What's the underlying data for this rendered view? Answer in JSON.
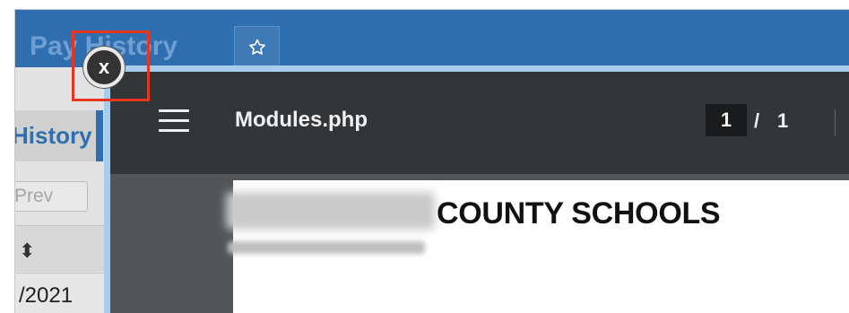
{
  "background_page": {
    "title": "Pay History",
    "tab_label": "History",
    "prev_button": "Prev",
    "sort_glyph": "⬍",
    "row_date": "/2021",
    "favorite_icon": "star-outline-icon"
  },
  "viewer": {
    "document_name": "Modules.php",
    "current_page": "1",
    "page_separator": "/",
    "total_pages": "1",
    "menu_icon": "hamburger-menu-icon"
  },
  "document": {
    "heading_visible": "COUNTY SCHOOLS"
  },
  "close_button": {
    "label": "x"
  },
  "colors": {
    "header_blue": "#2f6fb0",
    "viewer_toolbar": "#323639",
    "highlight_red": "#e8351f"
  }
}
